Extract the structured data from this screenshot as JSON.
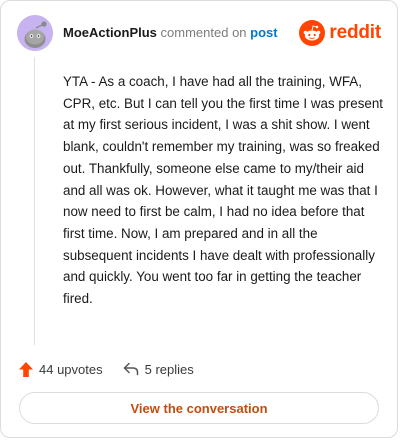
{
  "comment": {
    "username": "MoeActionPlus",
    "action_text": "commented on",
    "post_link": "post",
    "body": "YTA - As a coach, I have had all the training, WFA, CPR, etc. But I can tell you the first time I was present at my first serious incident, I was a shit show. I went blank, couldn't remember my training, was so freaked out. Thankfully, someone else came to my/their aid and all was ok. However, what it taught me was that I now need to first be calm, I had no idea before that first time. Now, I am prepared and in all the subsequent incidents I have dealt with professionally and quickly. You went too far in getting the teacher fired."
  },
  "brand": {
    "name": "reddit",
    "icon": "reddit-logo-icon",
    "color": "#ff4500"
  },
  "actions": {
    "upvotes": "44 upvotes",
    "upvote_icon": "upvote-arrow-icon",
    "replies": "5 replies",
    "reply_icon": "reply-arrow-icon"
  },
  "cta": {
    "label": "View the conversation",
    "color": "#c74b0e"
  },
  "colors": {
    "avatar_bg": "#c7b3f0",
    "link": "#0079d3"
  }
}
